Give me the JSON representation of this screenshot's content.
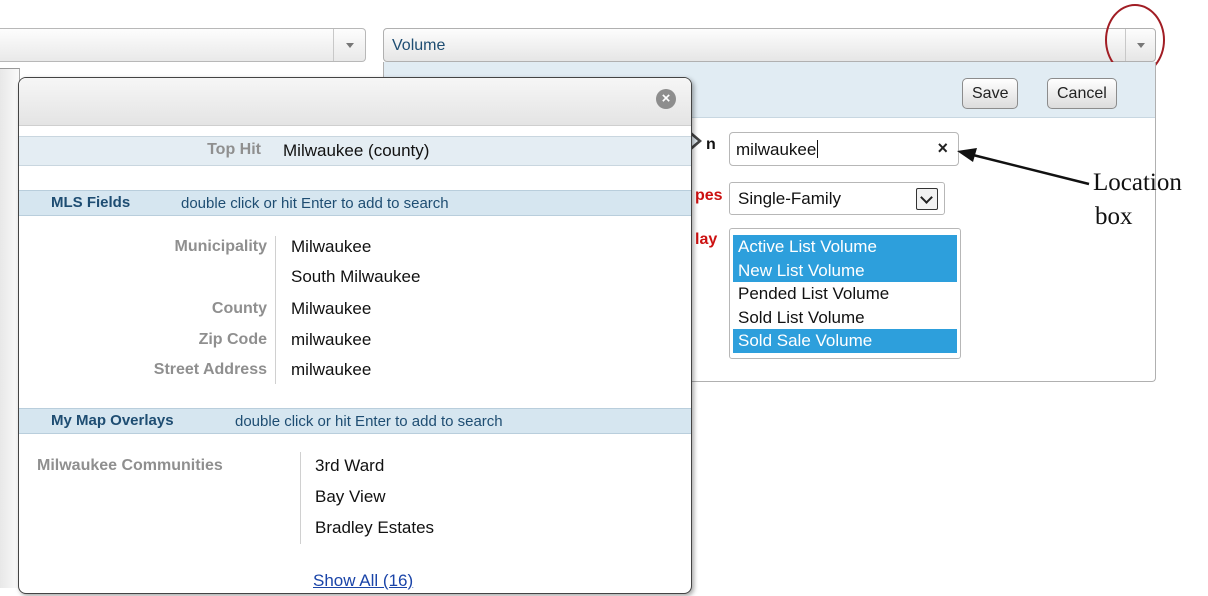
{
  "volume_combo": {
    "label": "Volume"
  },
  "settings": {
    "save_label": "Save",
    "cancel_label": "Cancel",
    "location_label_fragment": "n",
    "types_label_fragment": "pes",
    "display_label_fragment": "lay",
    "location_value": "milwaukee",
    "clear_glyph": "×",
    "property_type": "Single-Family",
    "display_options": [
      {
        "label": "Active List Volume",
        "selected": true
      },
      {
        "label": "New List Volume",
        "selected": true
      },
      {
        "label": "Pended List Volume",
        "selected": false
      },
      {
        "label": "Sold List Volume",
        "selected": false
      },
      {
        "label": "Sold Sale Volume",
        "selected": true
      }
    ]
  },
  "annotation": {
    "line1": "Location",
    "line2": "box"
  },
  "popup": {
    "close_glyph": "×",
    "top_hit": {
      "key": "Top Hit",
      "value": "Milwaukee  (county)"
    },
    "mls_fields": {
      "title": "MLS Fields",
      "hint": "double click or hit Enter to add to search",
      "rows": [
        {
          "label": "Municipality",
          "values": [
            "Milwaukee",
            "South Milwaukee"
          ]
        },
        {
          "label": "County",
          "values": [
            "Milwaukee"
          ]
        },
        {
          "label": "Zip Code",
          "values": [
            "milwaukee"
          ]
        },
        {
          "label": "Street Address",
          "values": [
            "milwaukee"
          ]
        }
      ]
    },
    "map_overlays": {
      "title": "My Map Overlays",
      "hint": "double click or hit Enter to add to search",
      "group_label": "Milwaukee Communities",
      "values": [
        "3rd Ward",
        "Bay View",
        "Bradley Estates"
      ]
    },
    "show_all": "Show All (16)"
  },
  "colors": {
    "accent_blue": "#1e4d72",
    "selected_option": "#2d9fdc",
    "required_label": "#cc1111",
    "annotation_circle": "#a11d24"
  }
}
